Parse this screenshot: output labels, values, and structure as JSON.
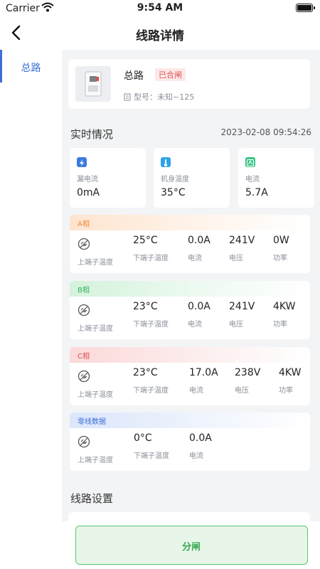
{
  "status_bar": {
    "carrier": "Carrier",
    "time": "9:54 AM"
  },
  "nav": {
    "title": "线路详情"
  },
  "sidebar": {
    "items": [
      {
        "label": "总路",
        "active": true
      }
    ]
  },
  "device": {
    "name": "总路",
    "status_tag": "已合闸",
    "model": "型号：未知~125"
  },
  "realtime": {
    "title": "实时情况",
    "timestamp": "2023-02-08 09:54:26",
    "cards": [
      {
        "label": "漏电流",
        "value": "0mA",
        "icon": "lightning-icon",
        "color": "#3a7be0"
      },
      {
        "label": "机身温度",
        "value": "35°C",
        "icon": "thermometer-icon",
        "color": "#2ea3e8"
      },
      {
        "label": "电流",
        "value": "5.7A",
        "icon": "current-icon",
        "color": "#2ec27e"
      }
    ]
  },
  "phases": [
    {
      "name": "A相",
      "color": "#f08a3c",
      "upper_label": "上端子温度",
      "cells": [
        {
          "value": "25°C",
          "label": "下端子温度"
        },
        {
          "value": "0.0A",
          "label": "电流"
        },
        {
          "value": "241V",
          "label": "电压"
        },
        {
          "value": "0W",
          "label": "功率"
        }
      ]
    },
    {
      "name": "B相",
      "color": "#34b35a",
      "upper_label": "上端子温度",
      "cells": [
        {
          "value": "23°C",
          "label": "下端子温度"
        },
        {
          "value": "0.0A",
          "label": "电流"
        },
        {
          "value": "241V",
          "label": "电压"
        },
        {
          "value": "4KW",
          "label": "功率"
        }
      ]
    },
    {
      "name": "C相",
      "color": "#e04c4c",
      "upper_label": "上端子温度",
      "cells": [
        {
          "value": "23°C",
          "label": "下端子温度"
        },
        {
          "value": "17.0A",
          "label": "电流"
        },
        {
          "value": "238V",
          "label": "电压"
        },
        {
          "value": "4KW",
          "label": "功率"
        }
      ]
    },
    {
      "name": "零线数据",
      "color": "#3a6fd8",
      "upper_label": "上端子温度",
      "cells": [
        {
          "value": "0°C",
          "label": "下端子温度"
        },
        {
          "value": "0.0A",
          "label": "电流"
        }
      ]
    }
  ],
  "settings": {
    "title": "线路设置"
  },
  "bottom": {
    "break_label": "分闸"
  }
}
